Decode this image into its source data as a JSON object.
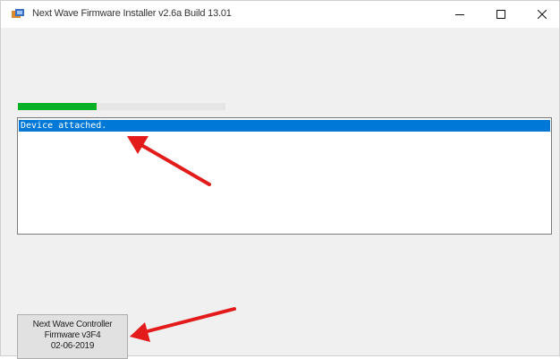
{
  "window": {
    "title": "Next Wave Firmware Installer v2.6a Build 13.01",
    "controls": {
      "minimize": "—",
      "maximize": "☐",
      "close": "✕"
    }
  },
  "progress": {
    "fraction": 0.38,
    "color": "#06b025"
  },
  "log": {
    "items": [
      {
        "text": "Device attached.",
        "selected": true
      }
    ]
  },
  "firmware_button": {
    "line1": "Next Wave Controller",
    "line2": "Firmware v3F4",
    "line3": "02-06-2019"
  },
  "annotation_color": "#e31b1b"
}
